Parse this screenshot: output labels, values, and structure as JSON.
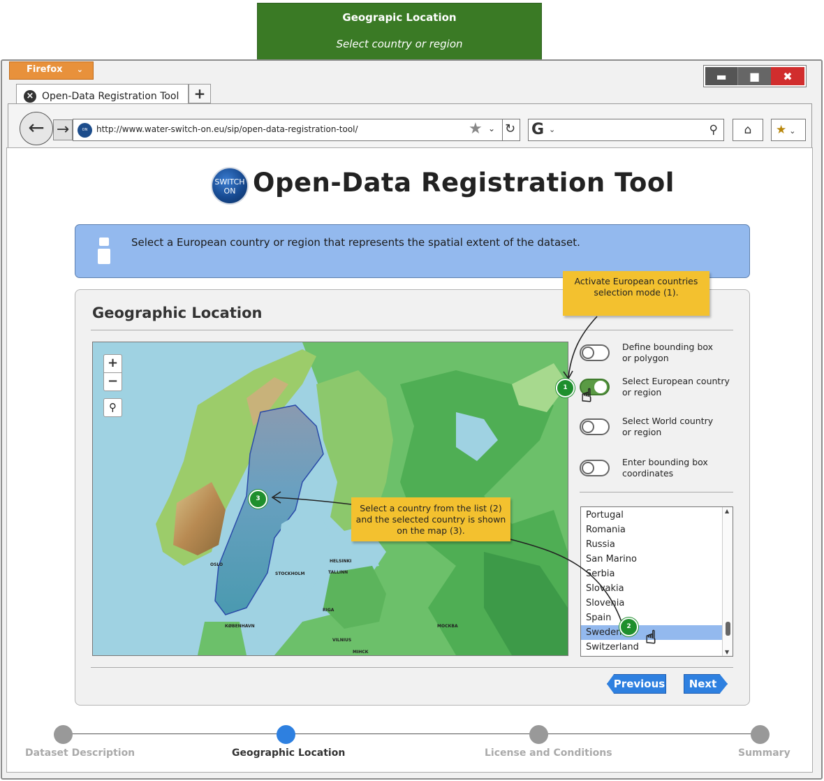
{
  "banner": {
    "title": "Geograpic Location",
    "subtitle": "Select country or region"
  },
  "browser": {
    "menu_label": "Firefox",
    "tab_title": "Open-Data Registration Tool",
    "new_tab": "+",
    "url": "http://www.water-switch-on.eu/sip/open-data-registration-tool/",
    "search_engine": "G",
    "icons": [
      "back-arrow-icon",
      "forward-icon",
      "star-icon",
      "reload-icon",
      "search-icon",
      "home-icon",
      "bookmarks-icon",
      "minimize-icon",
      "maximize-icon",
      "close-icon"
    ]
  },
  "logo": {
    "line1": "SWITCH",
    "line2": "ON"
  },
  "page_title": "Open-Data Registration Tool",
  "info_text": "Select a European country or region that represents the spatial extent of the dataset.",
  "panel": {
    "title": "Geographic Location",
    "options": [
      {
        "line1": "Define bounding box",
        "line2": "or polygon",
        "on": false
      },
      {
        "line1": "Select European country",
        "line2": "or region",
        "on": true
      },
      {
        "line1": "Select World country",
        "line2": "or region",
        "on": false
      },
      {
        "line1": "Enter bounding box",
        "line2": "coordinates",
        "on": false
      }
    ],
    "countries": [
      "Portugal",
      "Romania",
      "Russia",
      "San Marino",
      "Serbia",
      "Slovakia",
      "Slovenia",
      "Spain",
      "Sweden",
      "Switzerland"
    ],
    "selected_country": "Sweden",
    "previous_label": "Previous",
    "next_label": "Next"
  },
  "map": {
    "zoom_in": "+",
    "zoom_out": "−",
    "cities": [
      "OSLO",
      "STOCKHOLM",
      "HELSINKI",
      "TALLINN",
      "RIGA",
      "VILNIUS",
      "МОСКВА",
      "КØBENHAVN",
      "МІНСК"
    ]
  },
  "callouts": {
    "note1": [
      "Activate European countries",
      "selection mode (1)."
    ],
    "note2": [
      "Select a country from the list (2)",
      "and the selected country is shown",
      "on the map (3)."
    ],
    "markers": [
      "1",
      "2",
      "3"
    ]
  },
  "steps": [
    {
      "label": "Dataset Description",
      "active": false
    },
    {
      "label": "Geographic Location",
      "active": true
    },
    {
      "label": "License and Conditions",
      "active": false
    },
    {
      "label": "Summary",
      "active": false
    }
  ],
  "colors": {
    "accent": "#2e80e0",
    "banner": "#3a7a25",
    "info": "#93b9ee",
    "note": "#f3c12f",
    "marker": "#1f8f2d",
    "close": "#d12d2d"
  }
}
